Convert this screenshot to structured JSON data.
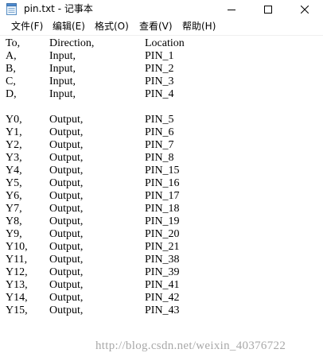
{
  "window": {
    "title": "pin.txt - 记事本",
    "minimize_icon": "minimize-icon",
    "maximize_icon": "maximize-icon",
    "close_icon": "close-icon"
  },
  "menu": [
    {
      "label": "文件(F)"
    },
    {
      "label": "编辑(E)"
    },
    {
      "label": "格式(O)"
    },
    {
      "label": "查看(V)"
    },
    {
      "label": "帮助(H)"
    }
  ],
  "content": {
    "rows": [
      {
        "a": "To,",
        "b": "Direction,",
        "c": "Location"
      },
      {
        "a": "A,",
        "b": "Input,",
        "c": "PIN_1"
      },
      {
        "a": "B,",
        "b": "Input,",
        "c": "PIN_2"
      },
      {
        "a": "C,",
        "b": "Input,",
        "c": "PIN_3"
      },
      {
        "a": "D,",
        "b": "Input,",
        "c": "PIN_4"
      },
      {
        "a": "",
        "b": "",
        "c": ""
      },
      {
        "a": "Y0,",
        "b": "Output,",
        "c": "PIN_5"
      },
      {
        "a": "Y1,",
        "b": "Output,",
        "c": "PIN_6"
      },
      {
        "a": "Y2,",
        "b": "Output,",
        "c": "PIN_7"
      },
      {
        "a": "Y3,",
        "b": "Output,",
        "c": "PIN_8"
      },
      {
        "a": "Y4,",
        "b": "Output,",
        "c": "PIN_15"
      },
      {
        "a": "Y5,",
        "b": "Output,",
        "c": "PIN_16"
      },
      {
        "a": "Y6,",
        "b": "Output,",
        "c": "PIN_17"
      },
      {
        "a": "Y7,",
        "b": "Output,",
        "c": "PIN_18"
      },
      {
        "a": "Y8,",
        "b": "Output,",
        "c": "PIN_19"
      },
      {
        "a": "Y9,",
        "b": "Output,",
        "c": "PIN_20"
      },
      {
        "a": "Y10,",
        "b": "Output,",
        "c": "PIN_21"
      },
      {
        "a": "Y11,",
        "b": "Output,",
        "c": "PIN_38"
      },
      {
        "a": "Y12,",
        "b": "Output,",
        "c": "PIN_39"
      },
      {
        "a": "Y13,",
        "b": "Output,",
        "c": "PIN_41"
      },
      {
        "a": "Y14,",
        "b": "Output,",
        "c": "PIN_42"
      },
      {
        "a": "Y15,",
        "b": "Output,",
        "c": "PIN_43"
      }
    ]
  },
  "watermark": "http://blog.csdn.net/weixin_40376722"
}
